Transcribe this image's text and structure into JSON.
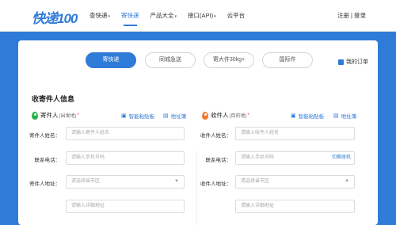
{
  "header": {
    "logo": "快递100",
    "nav": [
      {
        "label": "查快递",
        "caret": "▾"
      },
      {
        "label": "寄快递",
        "caret": ""
      },
      {
        "label": "产品大全",
        "caret": "▾"
      },
      {
        "label": "接口(API)",
        "caret": "▾"
      },
      {
        "label": "云平台",
        "caret": ""
      }
    ],
    "register": "注册",
    "separator": "|",
    "login": "登录"
  },
  "tabs": [
    "寄快递",
    "同城急送",
    "寄大件30kg+",
    "国际件"
  ],
  "my_orders": "我的订单",
  "section_title": "收寄件人信息",
  "sender": {
    "title": "寄件人",
    "subtitle": "(出发地)",
    "required": "*",
    "smart_paste": "智能粘贴板",
    "address_book": "地址簿",
    "name_label": "寄件人姓名：",
    "name_placeholder": "请输入寄件人姓名",
    "phone_label": "联系电话：",
    "phone_placeholder": "请输入手机号码",
    "address_label": "寄件人地址：",
    "region_placeholder": "请选择省市区",
    "detail_placeholder": "请输入详细地址"
  },
  "receiver": {
    "title": "收件人",
    "subtitle": "(目的地)",
    "required": "*",
    "smart_paste": "智能粘贴板",
    "address_book": "地址簿",
    "name_label": "收件人姓名：",
    "name_placeholder": "请输入收件人姓名",
    "phone_label": "联系电话：",
    "phone_placeholder": "请输入手机号码",
    "switch_landline": "切换座机",
    "address_label": "收件人地址：",
    "region_placeholder": "请选择省市区",
    "detail_placeholder": "请输入详细地址"
  },
  "colors": {
    "brand": "#2f7bd8",
    "sender_pin": "#25b04a",
    "receiver_pin": "#f07a2c"
  },
  "icons": {
    "paste": "clipboard-icon",
    "book": "address-book-icon",
    "dropdown": "chevron-down-icon",
    "orders": "orders-icon"
  }
}
